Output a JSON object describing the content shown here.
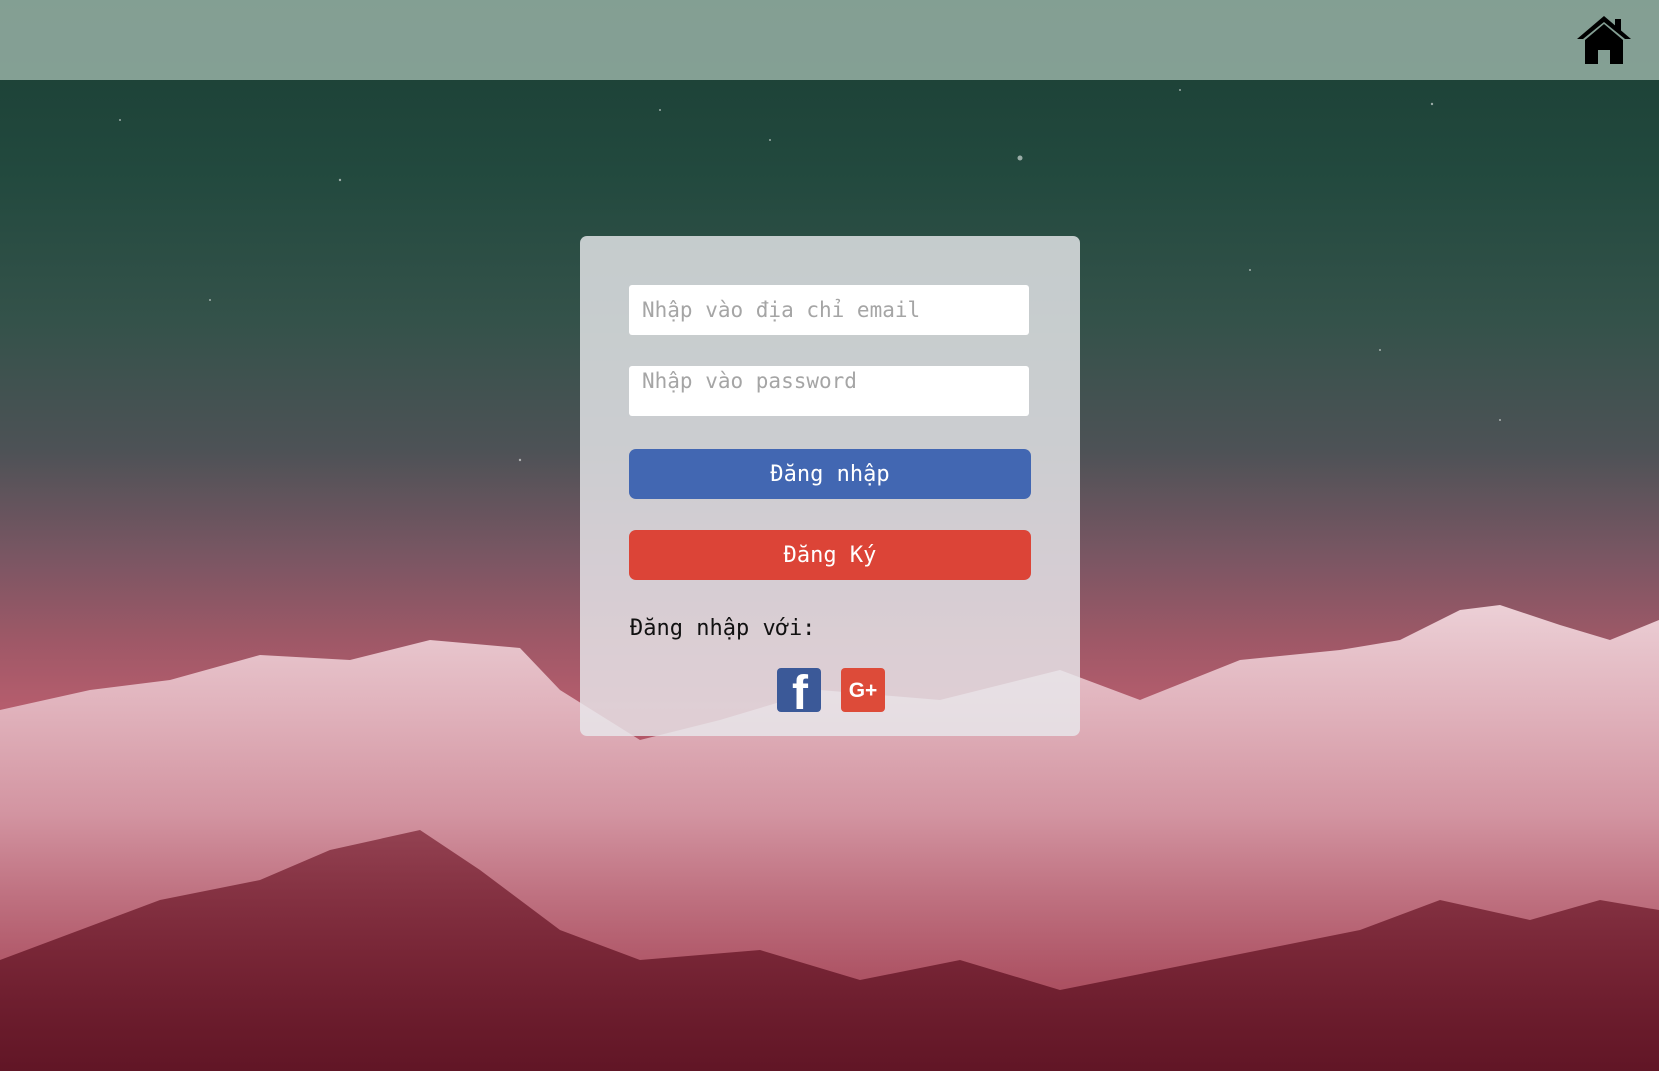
{
  "header": {
    "home_icon": "home-icon"
  },
  "login_form": {
    "email": {
      "value": "",
      "placeholder": "Nhập vào địa chỉ email"
    },
    "password": {
      "value": "",
      "placeholder": "Nhập vào password"
    },
    "login_button_label": "Đăng nhập",
    "signup_button_label": "Đăng Ký",
    "social_label": "Đăng nhập với:",
    "social": {
      "facebook": {
        "icon": "facebook-icon",
        "glyph": "f",
        "color": "#3b5998"
      },
      "google_plus": {
        "icon": "google-plus-icon",
        "glyph": "G+",
        "color": "#dd4b39"
      }
    }
  },
  "colors": {
    "login_button": "#4267b2",
    "signup_button": "#dc4437",
    "topbar": "#96b0a5"
  }
}
